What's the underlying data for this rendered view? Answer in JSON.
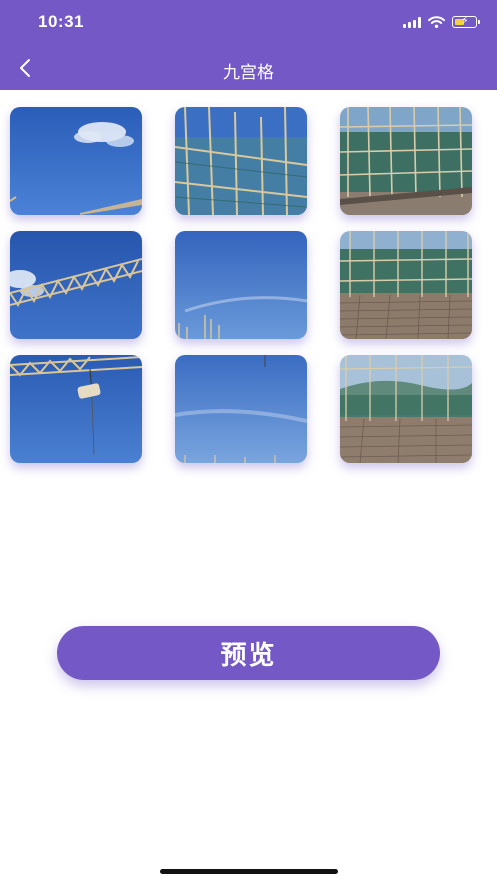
{
  "status_bar": {
    "time": "10:31"
  },
  "nav": {
    "title": "九宫格",
    "back_icon": "chevron-left-icon"
  },
  "grid": {
    "images": [
      {
        "name": "sky-with-cloud-photo",
        "scene": "sky-cloud"
      },
      {
        "name": "scaffold-against-sky-photo",
        "scene": "scaffold-sky"
      },
      {
        "name": "construction-site-scaffold-photo",
        "scene": "scaffold-ground"
      },
      {
        "name": "crane-arm-sky-photo",
        "scene": "crane-sky"
      },
      {
        "name": "clear-sky-scaffold-tops-photo",
        "scene": "sky-plain"
      },
      {
        "name": "rebar-floor-scaffold-photo",
        "scene": "rebar-floor"
      },
      {
        "name": "crane-hook-load-photo",
        "scene": "crane-hook"
      },
      {
        "name": "clear-sky-photo",
        "scene": "sky-plain2"
      },
      {
        "name": "rebar-floor-wide-photo",
        "scene": "rebar-floor2"
      }
    ]
  },
  "actions": {
    "preview_label": "预览"
  },
  "colors": {
    "accent": "#7358c6",
    "sky": "#3e6fc6"
  }
}
